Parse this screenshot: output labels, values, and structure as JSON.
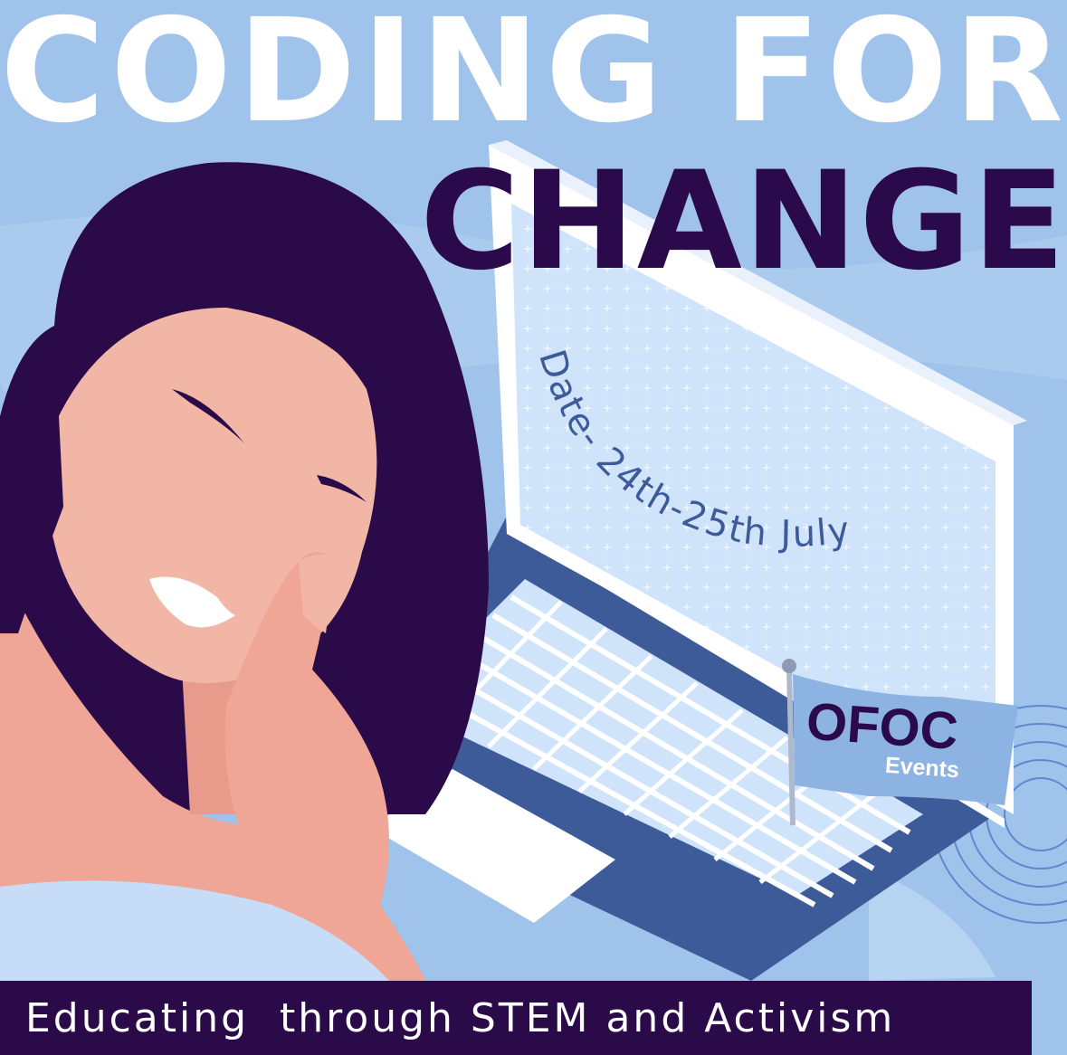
{
  "poster": {
    "title_line1": "CODING FOR",
    "title_line2": "CHANGE",
    "date_text": "Date- 24th-25th July",
    "flag_title": "OFOC",
    "flag_subtitle": "Events",
    "tagline": "Educating  through STEM and Activism"
  },
  "colors": {
    "background": "#9fc3ea",
    "dark_purple": "#2b0a4a",
    "skin": "#f2b6a6",
    "laptop_blue": "#3d5a99",
    "screen": "#cfe3fb"
  }
}
